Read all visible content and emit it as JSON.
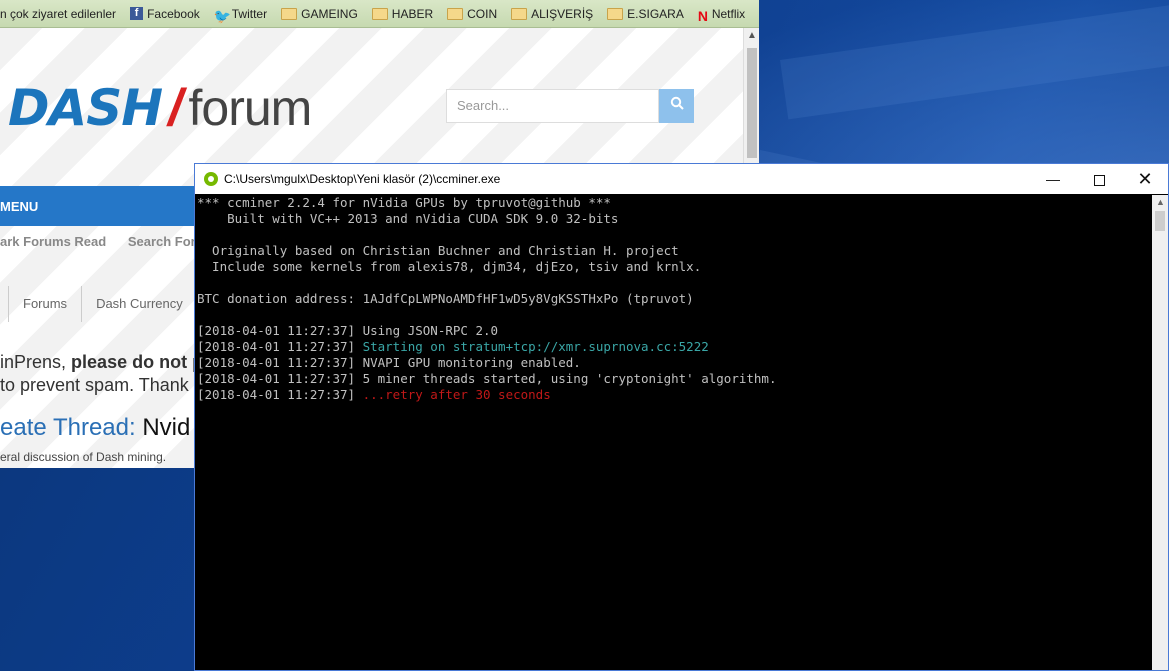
{
  "bookmarks": {
    "items": [
      {
        "label": "n çok ziyaret edilenler",
        "icon": "none"
      },
      {
        "label": "Facebook",
        "icon": "facebook-icon"
      },
      {
        "label": "Twitter",
        "icon": "twitter-icon"
      },
      {
        "label": "GAMEING",
        "icon": "folder-icon"
      },
      {
        "label": "HABER",
        "icon": "folder-icon"
      },
      {
        "label": "COIN",
        "icon": "folder-icon"
      },
      {
        "label": "ALIŞVERİŞ",
        "icon": "folder-icon"
      },
      {
        "label": "E.SIGARA",
        "icon": "folder-icon"
      },
      {
        "label": "Netflix",
        "icon": "netflix-icon"
      }
    ],
    "overflow": "»"
  },
  "forum": {
    "logo_dash": "DASH",
    "logo_slash": "/",
    "logo_forum": "forum",
    "search_placeholder": "Search...",
    "menu_label": "MENU",
    "subnav": [
      "ark Forums Read",
      "Search Forum"
    ],
    "breadcrumbs": [
      "Forums",
      "Dash Currency"
    ],
    "notice_line1_a": "inPrens, ",
    "notice_line1_b": "please do not p",
    "notice_line2": " to prevent spam. Thank",
    "create_label": "eate Thread:",
    "create_name": " Nvid",
    "description": "eral discussion of Dash mining."
  },
  "console": {
    "title": "C:\\Users\\mgulx\\Desktop\\Yeni klasör (2)\\ccminer.exe",
    "lines": [
      {
        "text": "*** ccminer 2.2.4 for nVidia GPUs by tpruvot@github ***",
        "color": "#c0c0c0"
      },
      {
        "text": "    Built with VC++ 2013 and nVidia CUDA SDK 9.0 32-bits",
        "color": "#c0c0c0"
      },
      {
        "text": "",
        "color": "#c0c0c0"
      },
      {
        "text": "  Originally based on Christian Buchner and Christian H. project",
        "color": "#c0c0c0"
      },
      {
        "text": "  Include some kernels from alexis78, djm34, djEzo, tsiv and krnlx.",
        "color": "#c0c0c0"
      },
      {
        "text": "",
        "color": "#c0c0c0"
      },
      {
        "text": "BTC donation address: 1AJdfCpLWPNoAMDfHF1wD5y8VgKSSTHxPo (tpruvot)",
        "color": "#c0c0c0"
      },
      {
        "text": "",
        "color": "#c0c0c0"
      }
    ],
    "log": [
      {
        "ts": "[2018-04-01 11:27:37] ",
        "msg": "Using JSON-RPC 2.0",
        "color": "#c0c0c0"
      },
      {
        "ts": "[2018-04-01 11:27:37] ",
        "msg": "Starting on stratum+tcp://xmr.suprnova.cc:5222",
        "color": "#3aa6a6"
      },
      {
        "ts": "[2018-04-01 11:27:37] ",
        "msg": "NVAPI GPU monitoring enabled.",
        "color": "#c0c0c0"
      },
      {
        "ts": "[2018-04-01 11:27:37] ",
        "msg": "5 miner threads started, using 'cryptonight' algorithm.",
        "color": "#c0c0c0"
      },
      {
        "ts": "[2018-04-01 11:27:37] ",
        "msg": "...retry after 30 seconds",
        "color": "#c01818"
      }
    ]
  }
}
